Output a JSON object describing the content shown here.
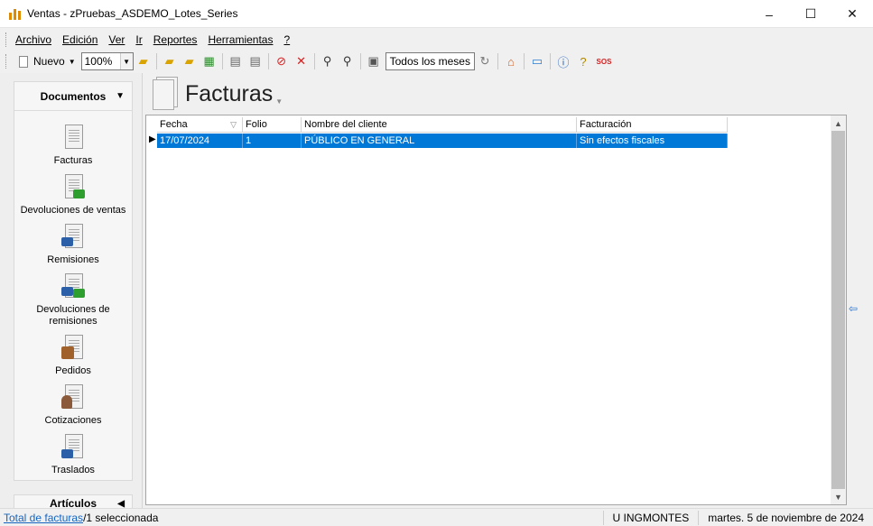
{
  "window": {
    "title": "Ventas - zPruebas_ASDEMO_Lotes_Series",
    "minimize": "–",
    "maximize": "☐",
    "close": "✕"
  },
  "menu": {
    "items": [
      "Archivo",
      "Edición",
      "Ver",
      "Ir",
      "Reportes",
      "Herramientas",
      "?"
    ]
  },
  "toolbar": {
    "new_label": "Nuevo",
    "zoom_value": "100%",
    "period_value": "Todos los meses",
    "sos_label": "SOS",
    "icons": [
      "folder-open-icon",
      "folder-import-icon",
      "folder-export-icon",
      "spreadsheet-icon",
      "print-icon",
      "print-preview-icon",
      "cancel-icon",
      "delete-icon",
      "find-icon",
      "find-next-icon",
      "zoom-icon",
      "refresh-icon",
      "home-icon",
      "window-icon",
      "help-icon",
      "question-icon"
    ]
  },
  "sidebar": {
    "section_title": "Documentos",
    "items": [
      {
        "label": "Facturas"
      },
      {
        "label": "Devoluciones de ventas"
      },
      {
        "label": "Remisiones"
      },
      {
        "label": "Devoluciones de remisiones"
      },
      {
        "label": "Pedidos"
      },
      {
        "label": "Cotizaciones"
      },
      {
        "label": "Traslados"
      }
    ],
    "second_section": "Artículos"
  },
  "content": {
    "title": "Facturas"
  },
  "grid": {
    "columns": [
      "Fecha",
      "Folio",
      "Nombre del cliente",
      "Facturación"
    ],
    "rows": [
      [
        "17/07/2024",
        "1",
        "PÚBLICO EN GENERAL",
        "Sin efectos fiscales"
      ]
    ]
  },
  "status": {
    "total_link": "Total de facturas",
    "selection": "/1 seleccionada",
    "user": "U  INGMONTES",
    "date": "martes. 5 de noviembre de 2024"
  },
  "colors": {
    "selection": "#0078d7",
    "link": "#1565c0",
    "accent_orange": "#e08a00"
  }
}
